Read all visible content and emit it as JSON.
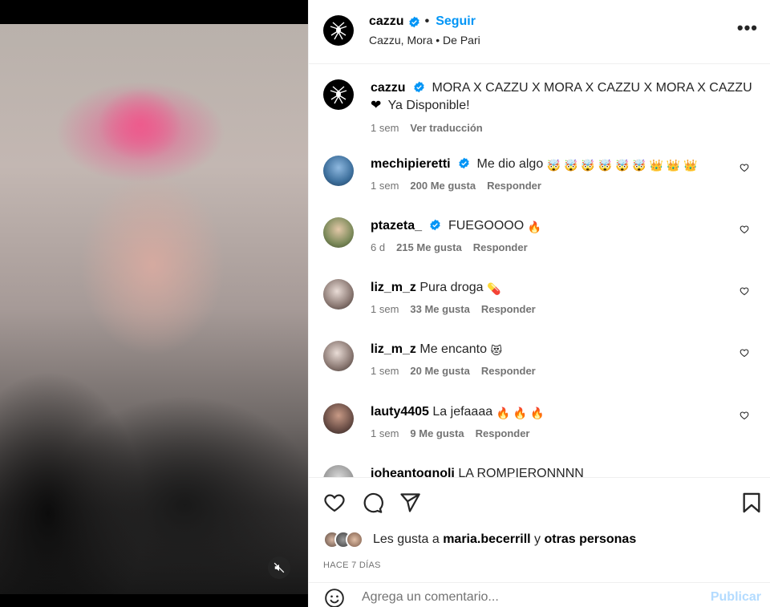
{
  "post": {
    "username": "cazzu",
    "follow_label": "Seguir",
    "dot": "•",
    "audio": "Cazzu, Mora • De Pari",
    "more": "•••"
  },
  "caption": {
    "username": "cazzu",
    "text": "MORA X CAZZU X MORA X CAZZU X MORA X CAZZU",
    "text2": "Ya Disponible!",
    "heart": "❤",
    "time": "1 sem",
    "translate": "Ver traducción"
  },
  "comments": [
    {
      "username": "mechipieretti",
      "verified": true,
      "text": "Me dio algo",
      "emojis": "🤯 🤯 🤯 🤯 🤯 🤯 👑 👑 👑",
      "time": "1 sem",
      "likes": "200 Me gusta",
      "reply": "Responder"
    },
    {
      "username": "ptazeta_",
      "verified": true,
      "text": "FUEGOOOO",
      "emojis": "🔥",
      "time": "6 d",
      "likes": "215 Me gusta",
      "reply": "Responder"
    },
    {
      "username": "liz_m_z",
      "verified": false,
      "text": "Pura droga",
      "emojis": "💊",
      "time": "1 sem",
      "likes": "33 Me gusta",
      "reply": "Responder"
    },
    {
      "username": "liz_m_z",
      "verified": false,
      "text": "Me encanto",
      "emojis": "😻",
      "time": "1 sem",
      "likes": "20 Me gusta",
      "reply": "Responder"
    },
    {
      "username": "lauty4405",
      "verified": false,
      "text": "La jefaaaa",
      "emojis": "🔥 🔥 🔥",
      "time": "1 sem",
      "likes": "9 Me gusta",
      "reply": "Responder"
    },
    {
      "username": "joheantognoli",
      "verified": false,
      "text": "LA ROMPIERONNNN",
      "emojis": "",
      "time": "",
      "likes": "",
      "reply": ""
    }
  ],
  "likes": {
    "prefix": "Les gusta a",
    "user": "maria.becerrill",
    "joiner": "y",
    "others": "otras personas"
  },
  "date": "HACE 7 DÍAS",
  "add_comment": {
    "placeholder": "Agrega un comentario...",
    "post": "Publicar"
  },
  "colors": {
    "accent": "#0095f6",
    "verified": "#0095f6",
    "muted": "#737373",
    "post_disabled": "#b3dbff"
  }
}
